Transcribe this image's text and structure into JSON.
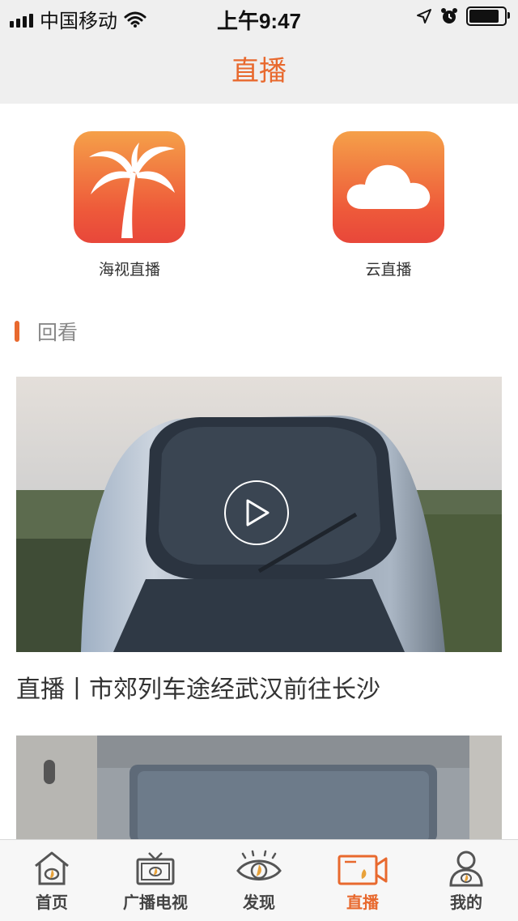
{
  "status_bar": {
    "carrier": "中国移动",
    "time": "上午9:47"
  },
  "nav": {
    "title": "直播"
  },
  "apps": [
    {
      "label": "海视直播",
      "icon": "palm-tree-icon"
    },
    {
      "label": "云直播",
      "icon": "cloud-icon"
    }
  ],
  "section": {
    "title": "回看"
  },
  "videos": [
    {
      "title": "直播丨市郊列车途经武汉前往长沙"
    }
  ],
  "tabs": [
    {
      "label": "首页",
      "icon": "home-icon"
    },
    {
      "label": "广播电视",
      "icon": "tv-icon"
    },
    {
      "label": "发现",
      "icon": "eye-icon"
    },
    {
      "label": "直播",
      "icon": "live-camera-icon",
      "active": true
    },
    {
      "label": "我的",
      "icon": "user-icon"
    }
  ],
  "colors": {
    "accent": "#e8692e",
    "bar_background": "#efefef"
  }
}
